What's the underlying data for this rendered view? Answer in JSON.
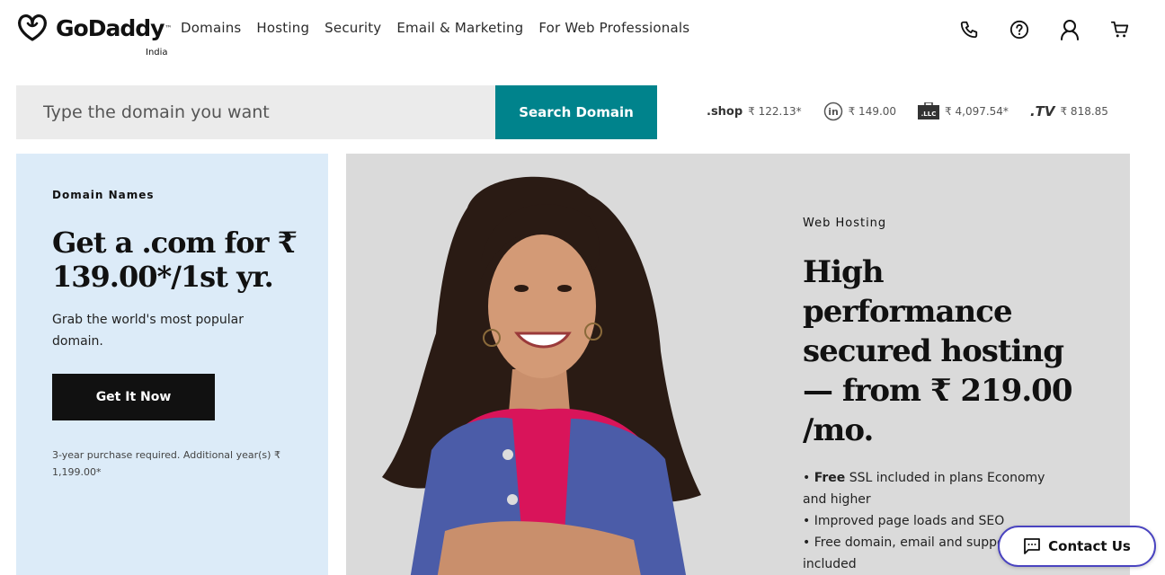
{
  "header": {
    "brand": "GoDaddy",
    "country": "India",
    "nav": [
      "Domains",
      "Hosting",
      "Security",
      "Email & Marketing",
      "For Web Professionals"
    ],
    "icons": [
      "phone-icon",
      "help-icon",
      "account-icon",
      "cart-icon"
    ]
  },
  "search": {
    "placeholder": "Type the domain you want",
    "button_label": "Search Domain"
  },
  "tlds": [
    {
      "name": ".shop",
      "price": "₹ 122.13*"
    },
    {
      "name": "in",
      "price": "₹ 149.00"
    },
    {
      "name": ".LLC",
      "price": "₹ 4,097.54*"
    },
    {
      "name": ".TV",
      "price": "₹ 818.85"
    }
  ],
  "domain_card": {
    "eyebrow": "Domain Names",
    "title": "Get a .com for ₹ 139.00*/1st yr.",
    "description": "Grab the world's most popular domain.",
    "button_label": "Get It Now",
    "note": "3-year purchase required. Additional year(s) ₹ 1,199.00*"
  },
  "hosting_card": {
    "eyebrow": "Web Hosting",
    "title": "High performance secured hosting — from ₹ 219.00 /mo.",
    "bullets": [
      {
        "bold": "Free",
        "text": " SSL included in plans Economy and higher"
      },
      {
        "bold": "",
        "text": "Improved page loads and SEO"
      },
      {
        "bold": "",
        "text": "Free domain, email and support included"
      }
    ]
  },
  "contact": {
    "label": "Contact Us"
  },
  "colors": {
    "accent": "#00838c",
    "domain_card_bg": "#dcebf8",
    "hosting_card_bg": "#dadada",
    "contact_border": "#4a44c0"
  }
}
